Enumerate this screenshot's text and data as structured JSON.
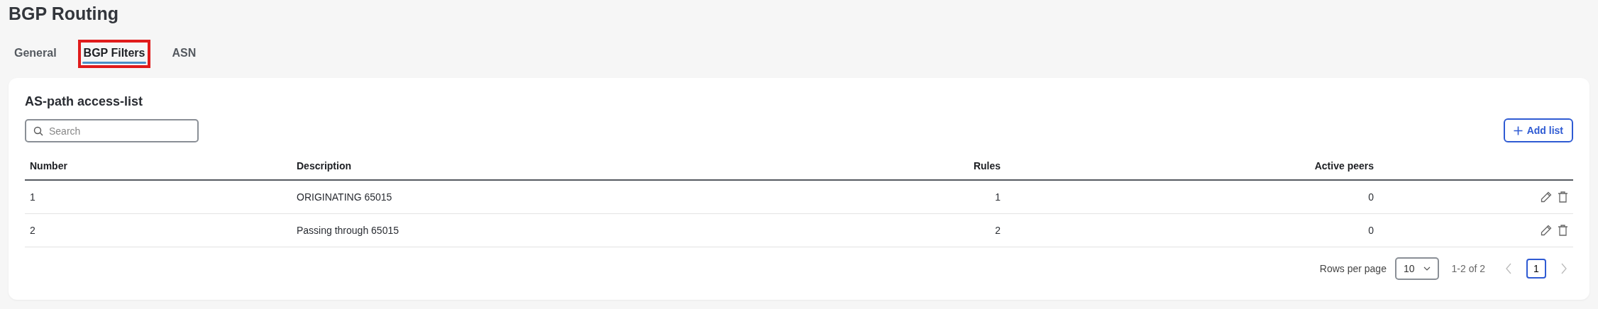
{
  "page": {
    "title": "BGP Routing"
  },
  "tabs": [
    {
      "label": "General",
      "selected": false,
      "highlighted": false
    },
    {
      "label": "BGP Filters",
      "selected": true,
      "highlighted": true
    },
    {
      "label": "ASN",
      "selected": false,
      "highlighted": false
    }
  ],
  "card": {
    "title": "AS-path access-list",
    "search": {
      "placeholder": "Search"
    },
    "add_button": {
      "label": "Add list"
    }
  },
  "table": {
    "columns": [
      {
        "label": "Number",
        "kind": "text"
      },
      {
        "label": "Description",
        "kind": "text"
      },
      {
        "label": "Rules",
        "kind": "numeric"
      },
      {
        "label": "Active peers",
        "kind": "numeric"
      }
    ],
    "rows": [
      {
        "cells": [
          "1",
          "ORIGINATING 65015",
          "1",
          "0"
        ]
      },
      {
        "cells": [
          "2",
          "Passing through 65015",
          "2",
          "0"
        ]
      }
    ]
  },
  "pagination": {
    "rows_label": "Rows per page",
    "rows_value": "10",
    "range": "1-2 of 2",
    "pages": [
      {
        "label": "1",
        "selected": true
      }
    ]
  }
}
